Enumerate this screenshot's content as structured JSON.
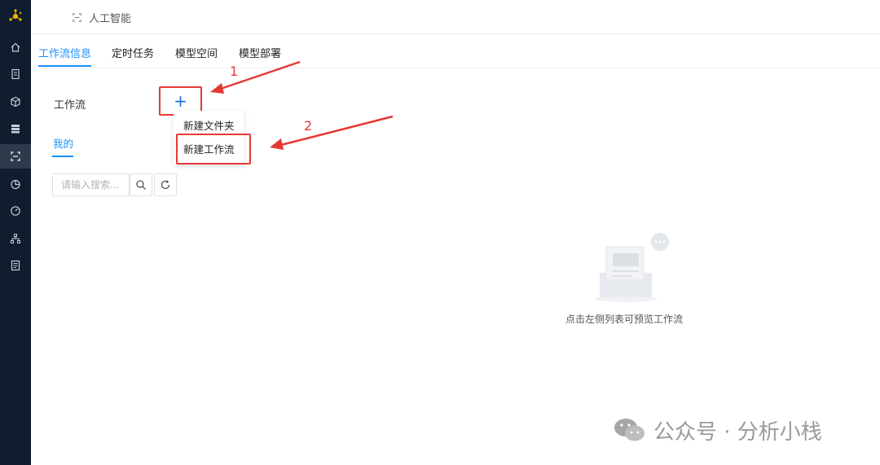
{
  "header": {
    "breadcrumb_icon": "scan-icon",
    "breadcrumb_label": "人工智能"
  },
  "sidebar": {
    "logo_icon": "network-logo-icon",
    "items": [
      {
        "icon": "home-icon"
      },
      {
        "icon": "document-icon"
      },
      {
        "icon": "cube-icon"
      },
      {
        "icon": "database-icon"
      },
      {
        "icon": "scan-icon",
        "active": true
      },
      {
        "icon": "pie-chart-icon"
      },
      {
        "icon": "gauge-icon"
      },
      {
        "icon": "org-chart-icon"
      },
      {
        "icon": "report-icon"
      }
    ]
  },
  "tabs": [
    {
      "label": "工作流信息",
      "active": true
    },
    {
      "label": "定时任务"
    },
    {
      "label": "模型空间"
    },
    {
      "label": "模型部署"
    }
  ],
  "workflow": {
    "title": "工作流",
    "add_label": "+",
    "menu": [
      "新建文件夹",
      "新建工作流"
    ],
    "subtab": "我的",
    "search_placeholder": "请输入搜索..."
  },
  "empty_state": {
    "text": "点击左侧列表可预览工作流"
  },
  "annotations": [
    "1",
    "2"
  ],
  "watermark": {
    "text": "公众号 · 分析小栈",
    "icon": "wechat-icon"
  },
  "colors": {
    "accent": "#1890ff",
    "annotation": "#e53935",
    "sidebar": "#0f1d2e"
  }
}
